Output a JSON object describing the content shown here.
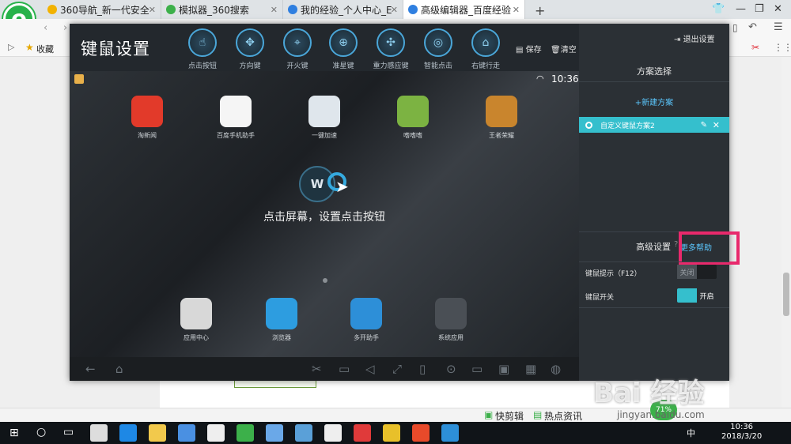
{
  "browser": {
    "tabs": [
      {
        "label": "360导航_新一代安全",
        "color": "#f2b200"
      },
      {
        "label": "模拟器_360搜索",
        "color": "#3cb04a"
      },
      {
        "label": "我的经验_个人中心_E",
        "color": "#2f7fe0"
      },
      {
        "label": "高级编辑器_百度经验",
        "color": "#2f7fe0"
      }
    ],
    "new_tab": "+",
    "bookmarks_label": "收藏",
    "status_items": [
      "快剪辑",
      "热点资讯"
    ]
  },
  "emulator": {
    "title": "键鼠设置",
    "tools": [
      {
        "label": "点击按钮",
        "glyph": "☝",
        "icon": "tap-icon"
      },
      {
        "label": "方向键",
        "glyph": "✥",
        "icon": "dpad-icon"
      },
      {
        "label": "开火键",
        "glyph": "⌖",
        "icon": "fire-icon"
      },
      {
        "label": "准星键",
        "glyph": "⊕",
        "icon": "crosshair-icon"
      },
      {
        "label": "重力感应键",
        "glyph": "✣",
        "icon": "gravity-icon"
      },
      {
        "label": "智能点击",
        "glyph": "◎",
        "icon": "smart-tap-icon"
      },
      {
        "label": "右键行走",
        "glyph": "⌂",
        "icon": "mouse-walk-icon"
      }
    ],
    "save": "保存",
    "clear": "清空",
    "clock": "10:36",
    "apps_top": [
      {
        "label": "淘新闻",
        "color": "#e23a2a"
      },
      {
        "label": "百度手机助手",
        "color": "#f5f5f5"
      },
      {
        "label": "一键加速",
        "color": "#dfe6ec"
      },
      {
        "label": "嗜嗜嗜",
        "color": "#7cb342"
      },
      {
        "label": "王者荣耀",
        "color": "#c9852d"
      }
    ],
    "apps_bottom": [
      {
        "label": "应用中心",
        "color": "#d8d8d8"
      },
      {
        "label": "浏览器",
        "color": "#2d9de0"
      },
      {
        "label": "多开助手",
        "color": "#2d8fd8"
      },
      {
        "label": "系统应用",
        "color": "#4a4f55"
      }
    ],
    "hint_letter": "W",
    "hint": "点击屏幕，设置点击按钮"
  },
  "panel": {
    "exit": "退出设置",
    "plan_title": "方案选择",
    "new_plan": "+新建方案",
    "current_plan": "自定义键鼠方案2",
    "advanced_title": "高级设置",
    "more_help": "更多帮助",
    "hint_row": "键鼠提示（F12）",
    "hint_state": "关闭",
    "switch_row": "键鼠开关",
    "switch_state": "开启"
  },
  "taskbar": {
    "time": "10:36",
    "date": "2018/3/20",
    "ime": "中",
    "battery": "71%"
  },
  "watermark": {
    "text": "Bai 经验",
    "url": "jingyan.baidu.com"
  }
}
